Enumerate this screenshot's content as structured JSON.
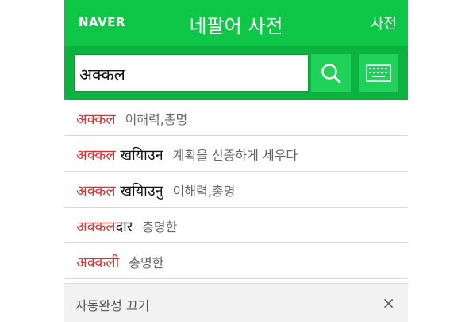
{
  "header": {
    "logo": "NAVER",
    "title": "네팔어 사전",
    "dict_link": "사전",
    "bg_color": "#0ec747"
  },
  "search": {
    "query": "अक्कल",
    "search_icon": "search-icon",
    "keyboard_icon": "keyboard-icon"
  },
  "suggestions": [
    {
      "match": "अक्कल",
      "rest": "",
      "meaning": "이해력,총명"
    },
    {
      "match": "अक्कल",
      "rest": " खयिाउन",
      "meaning": "계획을 신중하게 세우다"
    },
    {
      "match": "अक्कल",
      "rest": " खयिाउनु",
      "meaning": "이해력,총명"
    },
    {
      "match": "अक्कल",
      "rest": "दार",
      "meaning": "총명한"
    },
    {
      "match": "अक्कल",
      "rest": "ी",
      "meaning": "총명한"
    }
  ],
  "footer": {
    "label": "자동완성 끄기",
    "close": "×"
  },
  "colors": {
    "highlight": "#e03131",
    "accent": "#0ec747"
  }
}
